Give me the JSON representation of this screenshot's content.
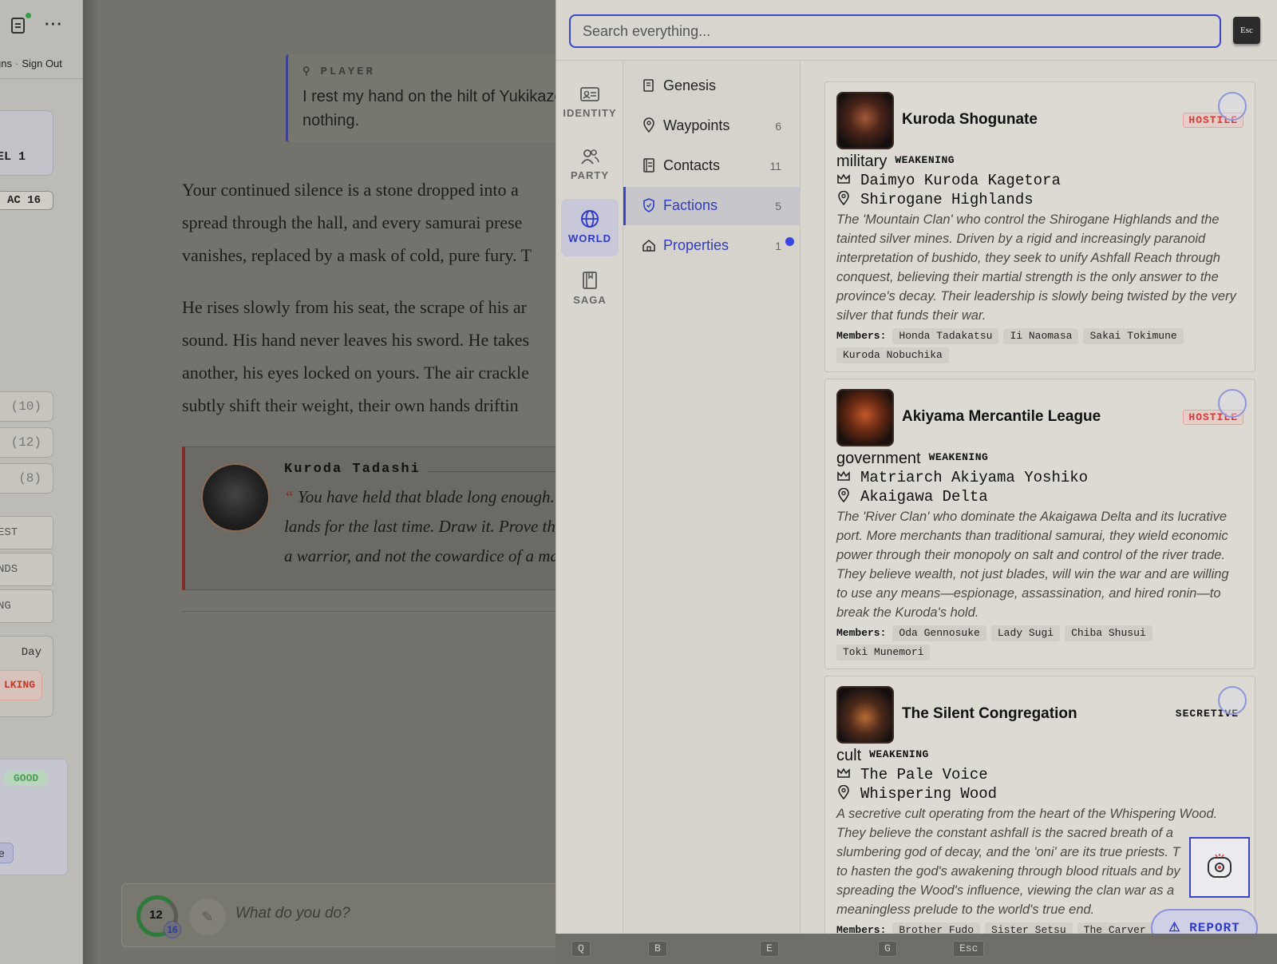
{
  "sidebar": {
    "links": [
      "gns",
      "Sign Out"
    ],
    "level": "EL 1",
    "ac": "AC 16",
    "stats": [
      "(10)",
      "(12)",
      "(8)"
    ],
    "actions": [
      "EST",
      "NDS",
      "NG"
    ],
    "day": "Day",
    "status": "LKING",
    "mood": "GOOD",
    "pill": "e"
  },
  "story": {
    "player_label": "PLAYER",
    "player_text": [
      "I rest my hand on the hilt of Yukikaze",
      "nothing."
    ],
    "paragraph1": [
      "Your continued silence is a stone dropped into a",
      "spread through the hall, and every samurai prese",
      "vanishes, replaced by a mask of cold, pure fury. T"
    ],
    "paragraph2": [
      "He rises slowly from his seat, the scrape of his ar",
      "sound. His hand never leaves his sword. He takes",
      "another, his eyes locked on yours. The air crackle",
      "subtly shift their weight, their own hands driftin"
    ],
    "npc_name": "Kuroda Tadashi",
    "npc_quote": [
      "You have held that blade long enough.",
      "lands for the last time. Draw it. Prove th",
      "a warrior, and not the cowardice of a ma"
    ],
    "turn": "12",
    "turn_sub": "16",
    "input_placeholder": "What do you do?"
  },
  "panel": {
    "search_placeholder": "Search everything...",
    "esc_label": "Esc",
    "rail": [
      {
        "label": "IDENTITY",
        "icon": "id-card-icon"
      },
      {
        "label": "PARTY",
        "icon": "party-icon"
      },
      {
        "label": "WORLD",
        "icon": "globe-icon",
        "active": true
      },
      {
        "label": "SAGA",
        "icon": "book-icon"
      }
    ],
    "subnav": [
      {
        "label": "Genesis",
        "count": "",
        "icon": "scroll-icon"
      },
      {
        "label": "Waypoints",
        "count": "6",
        "icon": "pin-icon"
      },
      {
        "label": "Contacts",
        "count": "11",
        "icon": "contacts-icon"
      },
      {
        "label": "Factions",
        "count": "5",
        "icon": "shield-icon",
        "active": true
      },
      {
        "label": "Properties",
        "count": "1",
        "icon": "house-icon"
      }
    ],
    "factions": [
      {
        "name": "Kuroda Shogunate",
        "standing": "HOSTILE",
        "type": "military",
        "trend": "WEAKENING",
        "leader": "Daimyo Kuroda Kagetora",
        "location": "Shirogane Highlands",
        "description": [
          "The 'Mountain Clan' who control the Shirogane Highlands and the",
          "tainted silver mines. Driven by a rigid and increasingly paranoid",
          "interpretation of bushido, they seek to unify Ashfall Reach through",
          "conquest, believing their martial strength is the only answer to the",
          "province's decay. Their leadership is slowly being twisted by the very",
          "silver that funds their war."
        ],
        "members_label": "Members:",
        "members": [
          "Honda Tadakatsu",
          "Ii Naomasa",
          "Sakai Tokimune",
          "Kuroda Nobuchika"
        ]
      },
      {
        "name": "Akiyama Mercantile League",
        "standing": "HOSTILE",
        "type": "government",
        "trend": "WEAKENING",
        "leader": "Matriarch Akiyama Yoshiko",
        "location": "Akaigawa Delta",
        "description": [
          "The 'River Clan' who dominate the Akaigawa Delta and its lucrative",
          "port. More merchants than traditional samurai, they wield economic",
          "power through their monopoly on salt and control of the river trade.",
          "They believe wealth, not just blades, will win the war and are willing",
          "to use any means—espionage, assassination, and hired ronin—to",
          "break the Kuroda's hold."
        ],
        "members_label": "Members:",
        "members": [
          "Oda Gennosuke",
          "Lady Sugi",
          "Chiba Shusui",
          "Toki Munemori"
        ]
      },
      {
        "name": "The Silent Congregation",
        "standing": "SECRETIVE",
        "type": "cult",
        "trend": "WEAKENING",
        "leader": "The Pale Voice",
        "location": "Whispering Wood",
        "description": [
          "A secretive cult operating from the heart of the Whispering Wood.",
          "They believe the constant ashfall is the sacred breath of a",
          "slumbering god of decay, and the 'oni' are its true priests. T",
          "to hasten the god's awakening through blood rituals and by",
          "spreading the Wood's influence, viewing the clan war as a",
          "meaningless prelude to the world's true end."
        ],
        "members_label": "Members:",
        "members": [
          "Brother Fudo",
          "Sister Setsu",
          "The Carver"
        ]
      }
    ],
    "report_label": "REPORT"
  },
  "footer": {
    "keys": [
      "Q",
      "B",
      "E",
      "G",
      "Esc"
    ]
  },
  "colors": {
    "accent": "#3a46c8",
    "hostile": "#d23b3b",
    "good": "#4e9a59",
    "player_bar": "#3c428f",
    "npc_bar": "#7b2f28"
  }
}
